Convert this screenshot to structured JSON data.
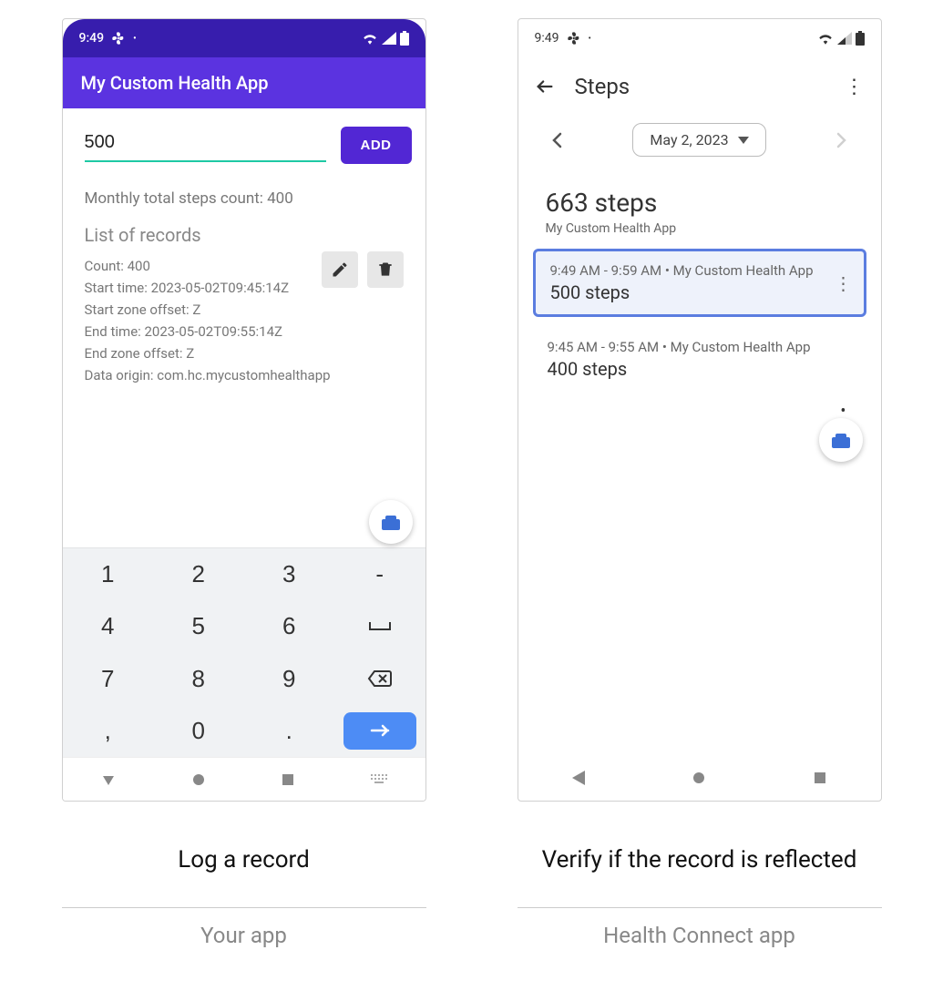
{
  "status_time": "9:49",
  "left": {
    "app_title": "My Custom Health App",
    "input_value": "500",
    "add_label": "ADD",
    "monthly_label": "Monthly total steps count: 400",
    "list_heading": "List of records",
    "record": {
      "count": "Count: 400",
      "start_time": "Start time: 2023-05-02T09:45:14Z",
      "start_zone": "Start zone offset: Z",
      "end_time": "End time: 2023-05-02T09:55:14Z",
      "end_zone": "End zone offset: Z",
      "origin": "Data origin: com.hc.mycustomhealthapp"
    },
    "keys": [
      "1",
      "2",
      "3",
      "-",
      "4",
      "5",
      "6",
      "␣",
      "7",
      "8",
      "9",
      "⌫",
      ",",
      "0",
      ".",
      "→"
    ],
    "caption": "Log a record",
    "subcaption": "Your app"
  },
  "right": {
    "title": "Steps",
    "date_label": "May 2, 2023",
    "summary_value": "663 steps",
    "summary_source": "My Custom Health App",
    "entries": [
      {
        "time": "9:49 AM - 9:59 AM • My Custom Health App",
        "value": "500 steps",
        "highlight": true
      },
      {
        "time": "9:45 AM - 9:55 AM • My Custom Health App",
        "value": "400 steps",
        "highlight": false
      }
    ],
    "caption": "Verify if the record is reflected",
    "subcaption": "Health Connect app"
  }
}
